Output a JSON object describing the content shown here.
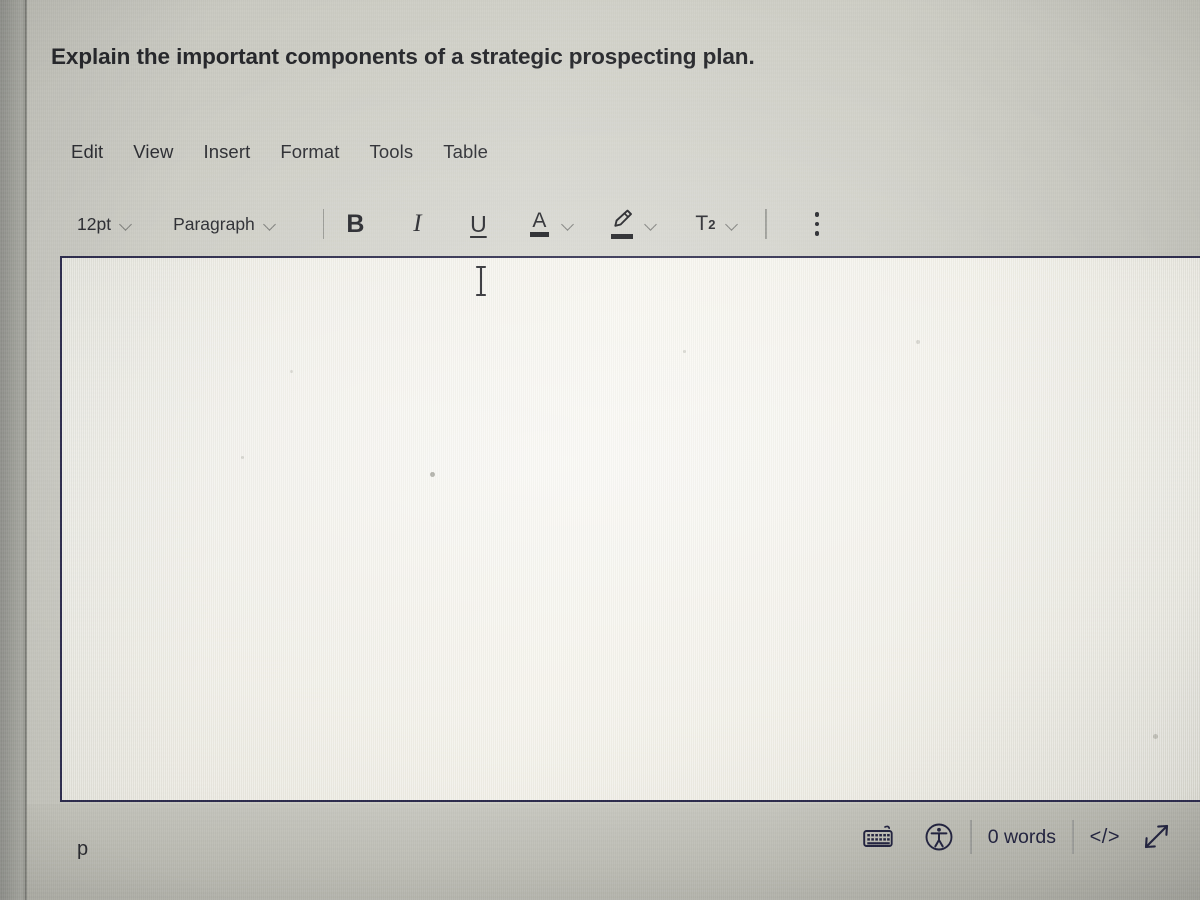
{
  "question": {
    "text": "Explain the important components of a strategic prospecting plan."
  },
  "menubar": {
    "items": [
      {
        "label": "Edit",
        "name": "menu-item-edit"
      },
      {
        "label": "View",
        "name": "menu-item-view"
      },
      {
        "label": "Insert",
        "name": "menu-item-insert"
      },
      {
        "label": "Format",
        "name": "menu-item-format"
      },
      {
        "label": "Tools",
        "name": "menu-item-tools"
      },
      {
        "label": "Table",
        "name": "menu-item-table"
      }
    ]
  },
  "toolbar": {
    "font_size": "12pt",
    "block_format": "Paragraph",
    "bold_label": "B",
    "italic_label": "I",
    "underline_label": "U",
    "text_color_label": "A",
    "superscript_label": "T",
    "superscript_exponent": "2",
    "icons": {
      "font_size_chevron": "chevron-down-icon",
      "block_format_chevron": "chevron-down-icon",
      "text_color_chevron": "chevron-down-icon",
      "highlight_icon": "highlighter-pen-icon",
      "highlight_chevron": "chevron-down-icon",
      "superscript_chevron": "chevron-down-icon",
      "more_options_icon": "kebab-menu-icon"
    }
  },
  "editor": {
    "body_text": "",
    "placeholder": "",
    "border_color": "#2e2d4e"
  },
  "footer": {
    "path_indicator": "p",
    "word_count": "0 words",
    "html_editor_label": "</>",
    "icons": {
      "keyboard": "keyboard-icon",
      "accessibility": "accessibility-checker-icon",
      "resize": "resize-diagonal-icon"
    }
  },
  "colors": {
    "editor_border": "#2e2d4e",
    "text": "#26272b",
    "status_text": "#23243f",
    "chevron": "#7c7d7a"
  }
}
